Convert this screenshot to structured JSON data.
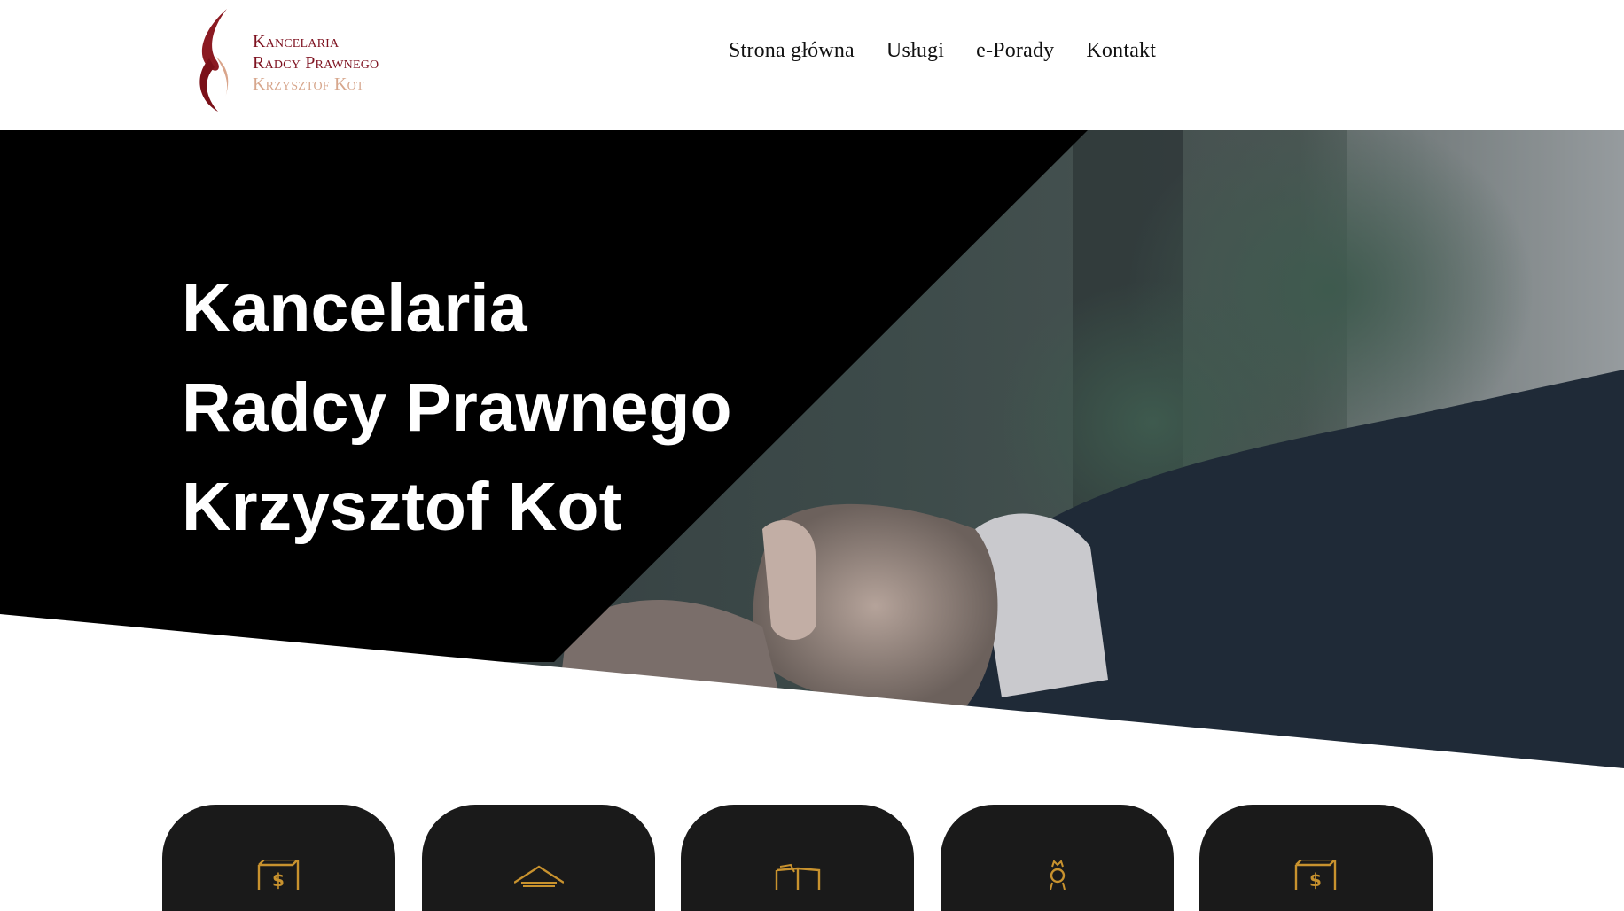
{
  "logo": {
    "line1": "Kancelaria",
    "line2": "Radcy Prawnego",
    "line3": "Krzysztof Kot",
    "colors": {
      "primary": "#7e1220",
      "secondary": "#d7a78d"
    }
  },
  "nav": {
    "items": [
      {
        "label": "Strona główna"
      },
      {
        "label": "Usługi"
      },
      {
        "label": "e-Porady"
      },
      {
        "label": "Kontakt"
      }
    ]
  },
  "hero": {
    "title_lines": [
      "Kancelaria",
      "Radcy Prawnego",
      "Krzysztof Kot"
    ],
    "background": "handshake-photo",
    "overlay_color": "#000000"
  },
  "cards": [
    {
      "icon": "money-document-icon"
    },
    {
      "icon": "roof-house-icon"
    },
    {
      "icon": "book-icon"
    },
    {
      "icon": "award-icon"
    },
    {
      "icon": "money-document-icon"
    }
  ],
  "colors": {
    "accent": "#c8922e",
    "card_bg": "#1a1a1a",
    "text_dark": "#111111"
  }
}
